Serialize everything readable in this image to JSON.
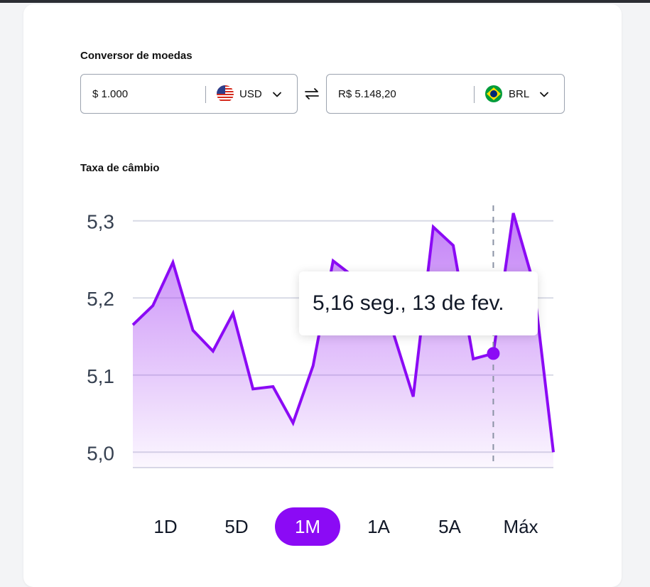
{
  "converter": {
    "label": "Conversor de moedas",
    "from": {
      "value": "$ 1.000",
      "currency": "USD",
      "flag_icon": "us-flag-icon"
    },
    "to": {
      "value": "R$ 5.148,20",
      "currency": "BRL",
      "flag_icon": "brazil-flag-icon"
    },
    "swap_icon": "swap-arrows-icon"
  },
  "rate_label": "Taxa de câmbio",
  "tooltip": {
    "text": "5,16 seg., 13 de fev."
  },
  "ranges": [
    {
      "label": "1D",
      "active": false
    },
    {
      "label": "5D",
      "active": false
    },
    {
      "label": "1M",
      "active": true
    },
    {
      "label": "1A",
      "active": false
    },
    {
      "label": "5A",
      "active": false
    },
    {
      "label": "Máx",
      "active": false
    }
  ],
  "colors": {
    "accent": "#8b0af5",
    "grid": "#d8dae6"
  },
  "chart_data": {
    "type": "area",
    "title": "",
    "xlabel": "",
    "ylabel": "",
    "ylim": [
      4.98,
      5.32
    ],
    "yticks": [
      "5,3",
      "5,2",
      "5,1",
      "5,0"
    ],
    "ytick_values": [
      5.3,
      5.2,
      5.1,
      5.0
    ],
    "grid": true,
    "series": [
      {
        "values": [
          5.165,
          5.19,
          5.246,
          5.158,
          5.131,
          5.18,
          5.082,
          5.085,
          5.038,
          5.112,
          5.248,
          5.228,
          5.205,
          5.155,
          5.072,
          5.292,
          5.268,
          5.121,
          5.128,
          5.31,
          5.22,
          5.0
        ]
      }
    ],
    "highlight_index": 18
  }
}
